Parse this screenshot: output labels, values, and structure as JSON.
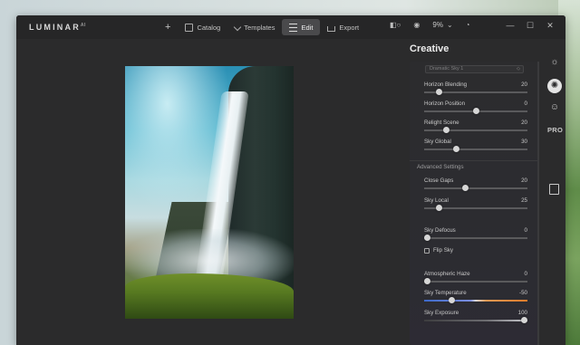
{
  "app": {
    "logo_text": "LUMINAR",
    "logo_suffix": "AI"
  },
  "nav": {
    "add_label": "+",
    "items": [
      {
        "label": "Catalog",
        "icon": "folder-icon"
      },
      {
        "label": "Templates",
        "icon": "templates-icon"
      },
      {
        "label": "Edit",
        "icon": "sliders-icon",
        "active": true
      },
      {
        "label": "Export",
        "icon": "export-icon"
      }
    ]
  },
  "toolbar": {
    "compare_icon": "compare-icon",
    "preview_icon": "eye-icon",
    "zoom_value": "9%",
    "zoom_chevron": "⌄",
    "history_icon": "clock-icon"
  },
  "window_controls": {
    "minimize": "—",
    "maximize": "☐",
    "close": "✕"
  },
  "panel": {
    "title": "Creative",
    "sky_preset": "Dramatic Sky 1",
    "sliders_top": [
      {
        "label": "Horizon Blending",
        "value": "20",
        "level": 0.12
      },
      {
        "label": "Horizon Position",
        "value": "0",
        "level": 0.5
      },
      {
        "label": "Relight Scene",
        "value": "20",
        "level": 0.2
      },
      {
        "label": "Sky Global",
        "value": "30",
        "level": 0.3
      }
    ],
    "advanced_label": "Advanced Settings",
    "sliders_advanced": [
      {
        "label": "Close Gaps",
        "value": "20",
        "level": 0.39
      },
      {
        "label": "Sky Local",
        "value": "25",
        "level": 0.12
      }
    ],
    "defocus": {
      "label": "Sky Defocus",
      "value": "0",
      "level": 0.0
    },
    "flip_sky_label": "Flip Sky",
    "flip_sky_checked": false,
    "sliders_bottom": [
      {
        "label": "Atmospheric Haze",
        "value": "0",
        "level": 0.0
      },
      {
        "label": "Sky Temperature",
        "value": "-50",
        "level": 0.25
      },
      {
        "label": "Sky Exposure",
        "value": "100",
        "level": 1.0
      }
    ]
  },
  "rail": {
    "icons": [
      "sun-icon",
      "palette-icon",
      "face-icon"
    ],
    "pro_label": "PRO",
    "frame_icon": "frame-icon"
  },
  "colors": {
    "window_bg": "#2b2b2c",
    "accent": "#8aa8c8"
  }
}
